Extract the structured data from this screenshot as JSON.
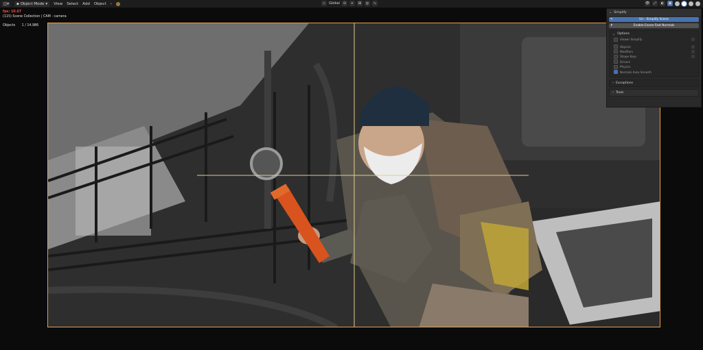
{
  "header": {
    "mode": "Object Mode",
    "menus": [
      "View",
      "Select",
      "Add",
      "Object"
    ],
    "transform_orientation": "Global"
  },
  "overlay": {
    "fps": "fps: 10.67",
    "collection": "(115) Scene Collection | CAM - camera",
    "objects_label": "Objects",
    "objects_count": "1 / 14,986"
  },
  "sidebar": {
    "panel_title": "Simplify",
    "unsimplify_button": "Un - Simplify Scene",
    "fast_normals_button": "Enable Eevee Fast Normals",
    "options": {
      "title": "Options",
      "items": [
        "Viewer Simplify",
        "Objects",
        "Modifiers",
        "Shape Keys",
        "Drivers",
        "Physics",
        "Normals Auto Smooth"
      ]
    },
    "exceptions_title": "Exceptions",
    "tools_title": "Tools"
  },
  "colors": {
    "accent": "#4772b3",
    "camera_border": "#e6a24a",
    "fps_text": "#ff4a3d",
    "wrench": "#d9531e"
  }
}
